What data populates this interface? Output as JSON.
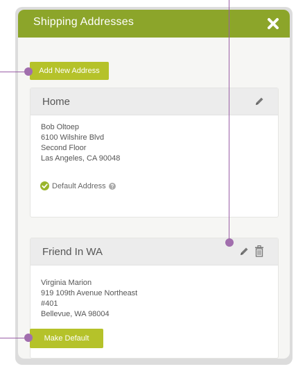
{
  "dialog": {
    "title": "Shipping Addresses",
    "close_icon": "close-icon"
  },
  "actions": {
    "add_new_address_label": "Add New Address",
    "make_default_label": "Make Default"
  },
  "addresses": [
    {
      "label": "Home",
      "lines": [
        "Bob Oltoep",
        "6100 Wilshire Blvd",
        "Second Floor",
        "Las Angeles, CA 90048"
      ],
      "default_label": "Default Address",
      "is_default": true,
      "icons": [
        "pencil-icon"
      ]
    },
    {
      "label": "Friend In WA",
      "lines": [
        "Virginia Marion",
        "919 109th Avenue Northeast",
        "#401",
        "Bellevue, WA 98004"
      ],
      "is_default": false,
      "icons": [
        "pencil-icon",
        "trash-icon"
      ]
    }
  ],
  "colors": {
    "header": "#8ca52a",
    "button": "#b5c22a",
    "callout": "#9a5ea6"
  }
}
